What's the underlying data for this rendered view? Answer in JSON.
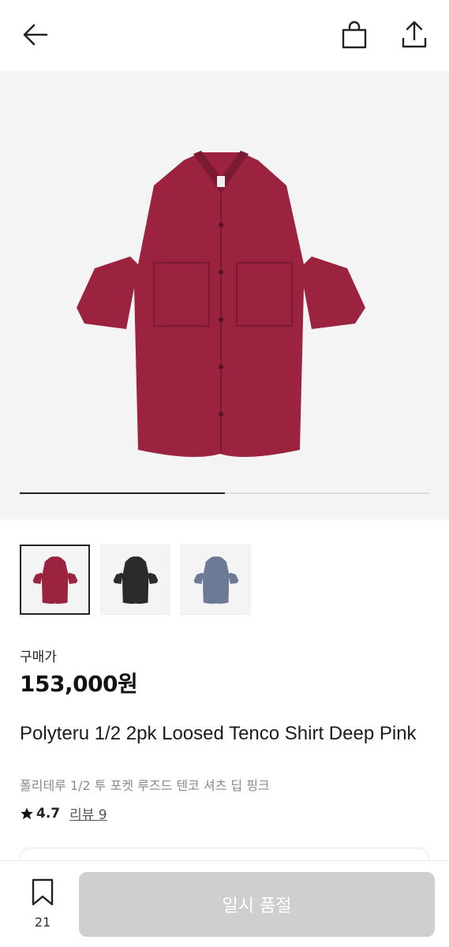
{
  "icons": {
    "back": "arrow-left",
    "bag": "shopping-bag",
    "share": "share-upload",
    "bookmark": "bookmark-outline",
    "star": "star-filled"
  },
  "colors": {
    "shirt_deep_pink": "#9c2340",
    "shirt_black": "#2a2a2d",
    "shirt_blue": "#6c7a96",
    "soldout_button": "#cfcfcf",
    "progress_active": "#222222"
  },
  "gallery": {
    "progress_fraction": 0.5,
    "thumbnails": [
      {
        "alt": "deep pink",
        "selected": true
      },
      {
        "alt": "black",
        "selected": false
      },
      {
        "alt": "blue",
        "selected": false
      }
    ]
  },
  "product": {
    "price_label": "구매가",
    "price": "153,000원",
    "title": "Polyteru 1/2 2pk Loosed Tenco Shirt Deep Pink",
    "subtitle": "폴리테루 1/2 투 포켓 루즈드 텐코 셔츠 딥 핑크",
    "rating": "4.7",
    "review_link": "리뷰 9"
  },
  "bottom_bar": {
    "bookmark_count": "21",
    "soldout_label": "일시 품절"
  }
}
